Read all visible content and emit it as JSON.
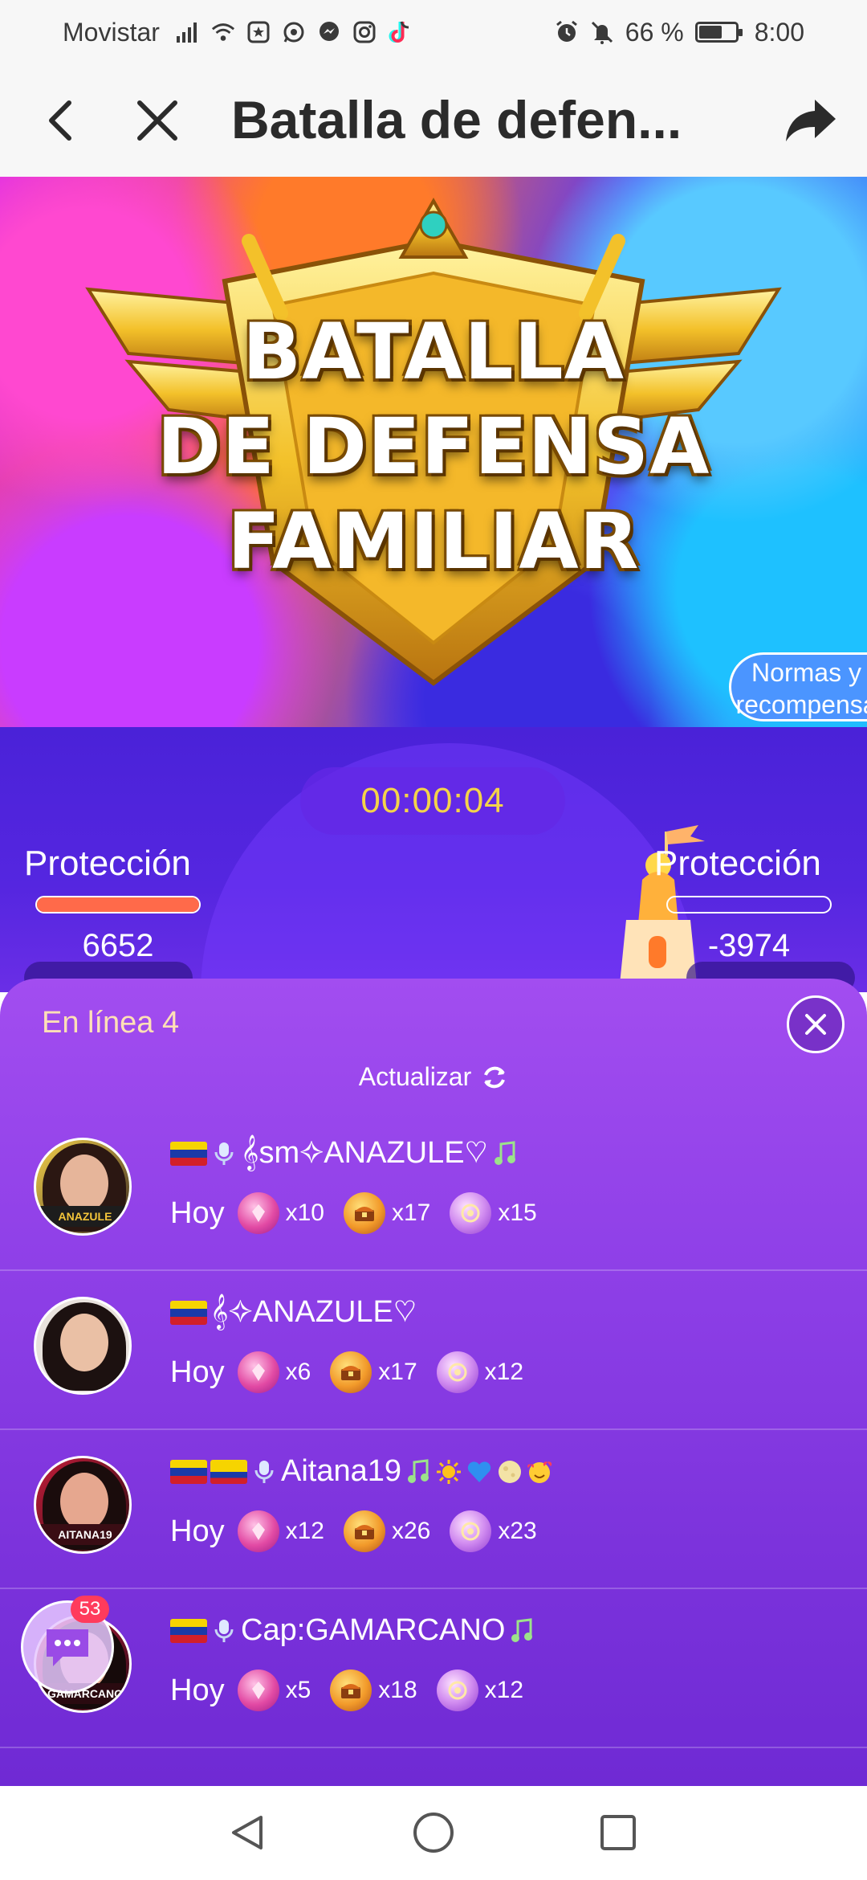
{
  "status_bar": {
    "carrier": "Movistar",
    "battery_text": "66 %",
    "battery_level": 0.66,
    "time": "8:00",
    "icons": [
      "signal-icon",
      "wifi-icon",
      "app-notification-icon",
      "whatsapp-icon",
      "messenger-icon",
      "instagram-icon",
      "tiktok-icon",
      "alarm-icon",
      "mute-icon",
      "battery-icon"
    ]
  },
  "header": {
    "title": "Batalla de defen...",
    "back_icon": "chevron-left-icon",
    "close_icon": "close-icon",
    "share_icon": "share-icon"
  },
  "banner": {
    "title_lines": [
      "BATALLA",
      "DE DEFENSA",
      "FAMILIAR"
    ],
    "rules_button": "Normas y recompensa"
  },
  "battle": {
    "timer": "00:00:04",
    "left": {
      "label": "Protección",
      "score": "6652",
      "bar_fill": 1.0,
      "bar_color": "#ff6a4a"
    },
    "right": {
      "label": "Protección",
      "score": "-3974",
      "bar_fill": 0.0,
      "bar_color": "#7b3df0"
    }
  },
  "online_panel": {
    "title": "En línea 4",
    "refresh_label": "Actualizar",
    "users": [
      {
        "name": "𝄞sm✧ANAZULE♡",
        "day": "Hoy",
        "gifts": [
          "x10",
          "x17",
          "x15"
        ]
      },
      {
        "name": "𝄞✧ANAZULE♡",
        "day": "Hoy",
        "gifts": [
          "x6",
          "x17",
          "x12"
        ]
      },
      {
        "name": "Aitana19",
        "day": "Hoy",
        "gifts": [
          "x12",
          "x26",
          "x23"
        ]
      },
      {
        "name": "Cap:GAMARCANO",
        "day": "Hoy",
        "gifts": [
          "x5",
          "x18",
          "x12"
        ]
      }
    ],
    "avatar_tags": [
      "ANAZULE",
      "",
      "AITANA19",
      "GAMARCANO"
    ]
  },
  "chat_bubble": {
    "badge": "53"
  },
  "colors": {
    "accent_gold": "#f4d34a",
    "sheet_purple": "#8c3ee6",
    "online_text": "#ffe0b6"
  }
}
